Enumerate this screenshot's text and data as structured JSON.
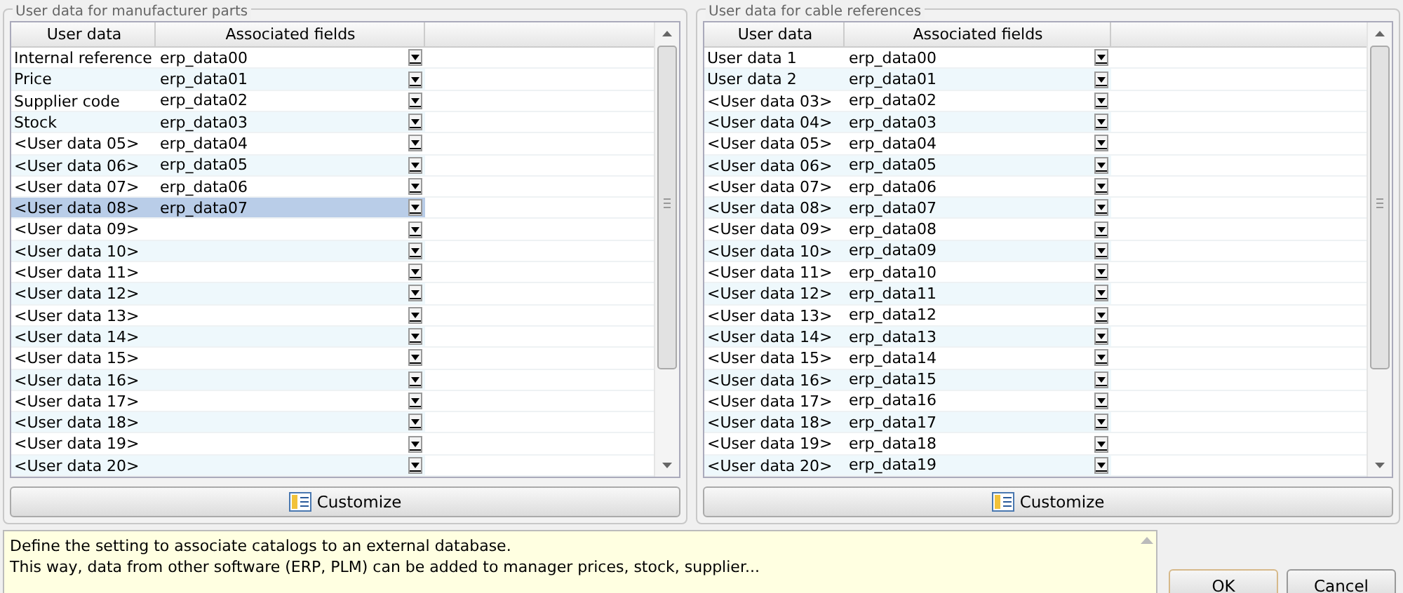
{
  "panels": [
    {
      "title": "User data for manufacturer parts",
      "columns": [
        "User data",
        "Associated fields"
      ],
      "rows": [
        {
          "user_data": "Internal reference",
          "field": "erp_data00",
          "selected": false
        },
        {
          "user_data": "Price",
          "field": "erp_data01",
          "selected": false
        },
        {
          "user_data": "Supplier code",
          "field": "erp_data02",
          "selected": false
        },
        {
          "user_data": "Stock",
          "field": "erp_data03",
          "selected": false
        },
        {
          "user_data": "<User data 05>",
          "field": "erp_data04",
          "selected": false
        },
        {
          "user_data": "<User data 06>",
          "field": "erp_data05",
          "selected": false
        },
        {
          "user_data": "<User data 07>",
          "field": "erp_data06",
          "selected": false
        },
        {
          "user_data": "<User data 08>",
          "field": "erp_data07",
          "selected": true
        },
        {
          "user_data": "<User data 09>",
          "selected": false
        },
        {
          "user_data": "<User data 10>",
          "selected": false
        },
        {
          "user_data": "<User data 11>",
          "selected": false
        },
        {
          "user_data": "<User data 12>",
          "selected": false
        },
        {
          "user_data": "<User data 13>",
          "selected": false
        },
        {
          "user_data": "<User data 14>",
          "selected": false
        },
        {
          "user_data": "<User data 15>",
          "selected": false
        },
        {
          "user_data": "<User data 16>",
          "selected": false
        },
        {
          "user_data": "<User data 17>",
          "selected": false
        },
        {
          "user_data": "<User data 18>",
          "selected": false
        },
        {
          "user_data": "<User data 19>",
          "selected": false
        },
        {
          "user_data": "<User data 20>",
          "selected": false
        }
      ],
      "button": "Customize"
    },
    {
      "title": "User data for cable references",
      "columns": [
        "User data",
        "Associated fields"
      ],
      "rows": [
        {
          "user_data": "User data 1",
          "field": "erp_data00",
          "selected": false
        },
        {
          "user_data": "User data 2",
          "field": "erp_data01",
          "selected": false
        },
        {
          "user_data": "<User data 03>",
          "field": "erp_data02",
          "selected": false
        },
        {
          "user_data": "<User data 04>",
          "field": "erp_data03",
          "selected": false
        },
        {
          "user_data": "<User data 05>",
          "field": "erp_data04",
          "selected": false
        },
        {
          "user_data": "<User data 06>",
          "field": "erp_data05",
          "selected": false
        },
        {
          "user_data": "<User data 07>",
          "field": "erp_data06",
          "selected": false
        },
        {
          "user_data": "<User data 08>",
          "field": "erp_data07",
          "selected": false
        },
        {
          "user_data": "<User data 09>",
          "field": "erp_data08",
          "selected": false
        },
        {
          "user_data": "<User data 10>",
          "field": "erp_data09",
          "selected": false
        },
        {
          "user_data": "<User data 11>",
          "field": "erp_data10",
          "selected": false
        },
        {
          "user_data": "<User data 12>",
          "field": "erp_data11",
          "selected": false
        },
        {
          "user_data": "<User data 13>",
          "field": "erp_data12",
          "selected": false
        },
        {
          "user_data": "<User data 14>",
          "field": "erp_data13",
          "selected": false
        },
        {
          "user_data": "<User data 15>",
          "field": "erp_data14",
          "selected": false
        },
        {
          "user_data": "<User data 16>",
          "field": "erp_data15",
          "selected": false
        },
        {
          "user_data": "<User data 17>",
          "field": "erp_data16",
          "selected": false
        },
        {
          "user_data": "<User data 18>",
          "field": "erp_data17",
          "selected": false
        },
        {
          "user_data": "<User data 19>",
          "field": "erp_data18",
          "selected": false
        },
        {
          "user_data": "<User data 20>",
          "field": "erp_data19",
          "selected": false
        }
      ],
      "button": "Customize"
    }
  ],
  "help_text": [
    "Define the setting to associate catalogs to an external database.",
    "This way, data from other software (ERP, PLM) can be added to manager prices, stock, supplier..."
  ],
  "buttons": [
    "OK",
    "Cancel"
  ]
}
